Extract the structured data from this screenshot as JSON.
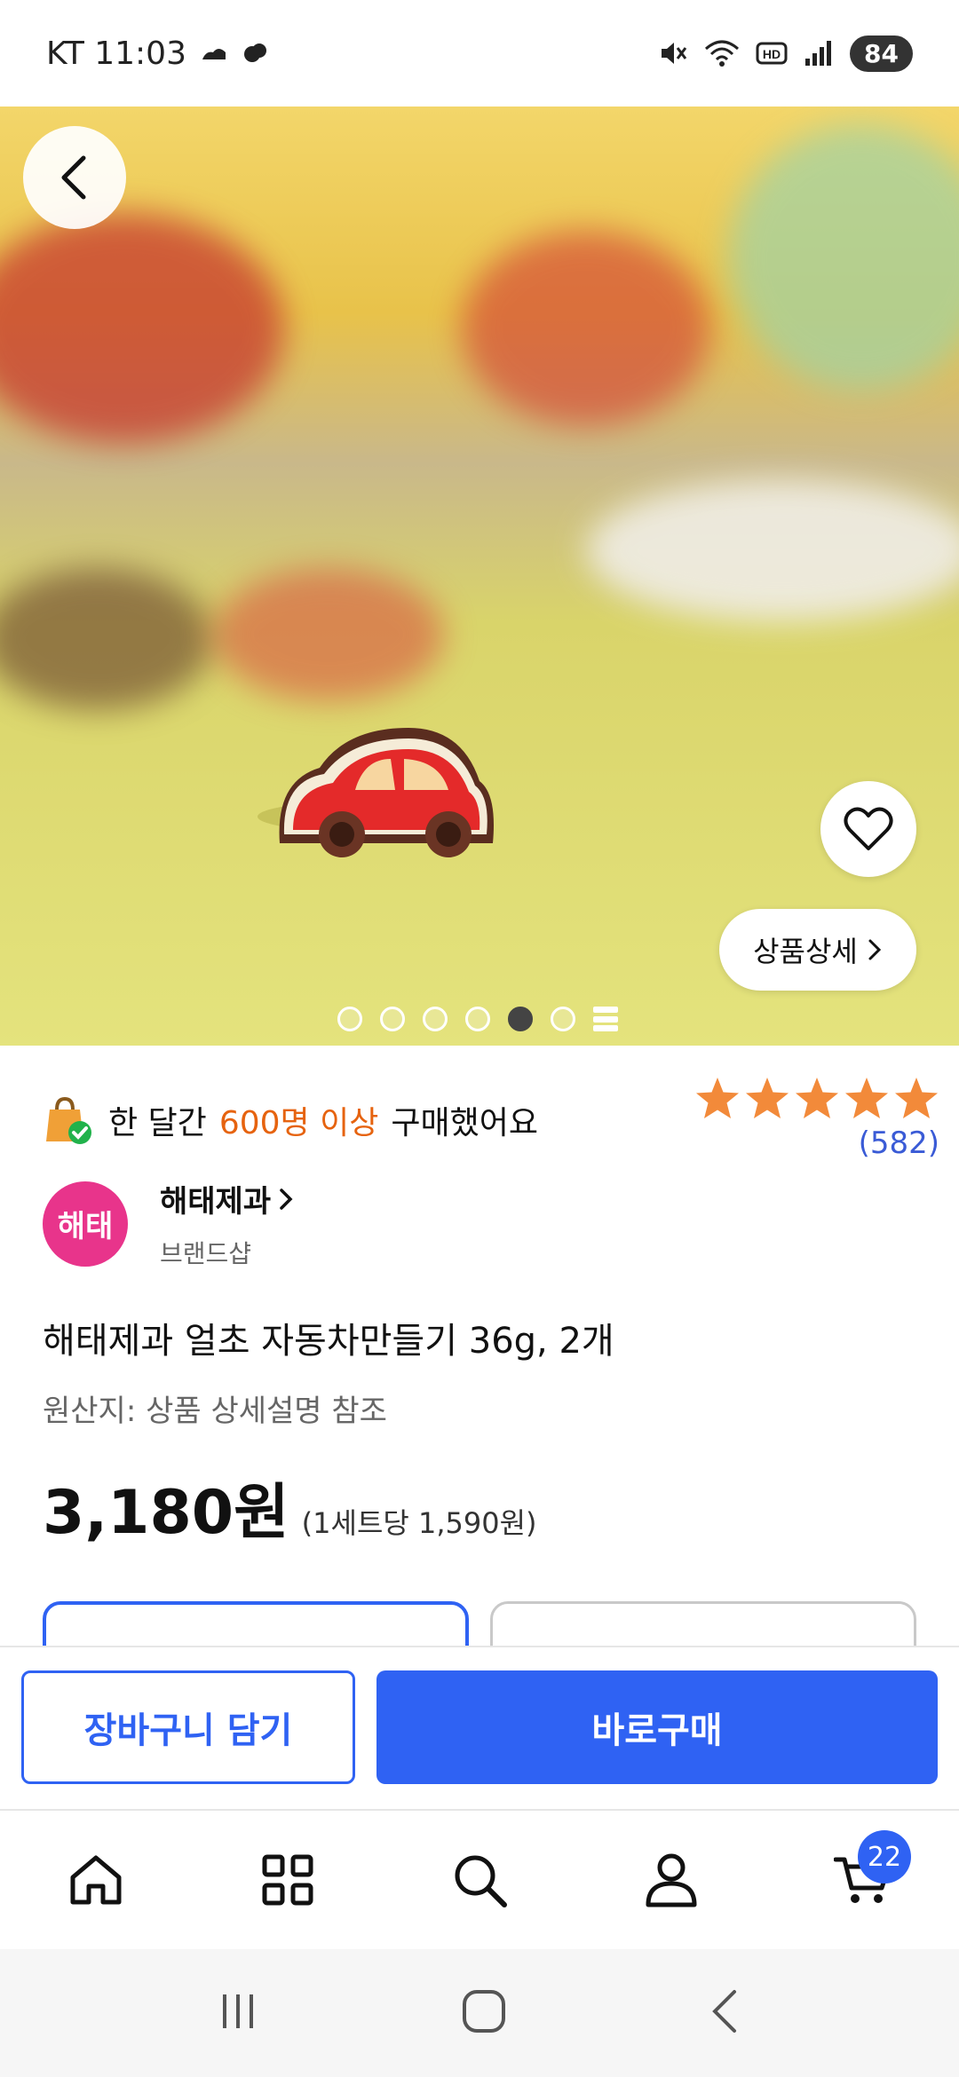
{
  "status_bar": {
    "carrier_time": "KT 11:03",
    "battery": "84"
  },
  "hero": {
    "detail_button_label": "상품상세",
    "slide_count": 6,
    "active_slide": 5
  },
  "social_proof": {
    "prefix": "한 달간",
    "highlight": "600명 이상",
    "suffix": "구매했어요"
  },
  "rating": {
    "stars": 5,
    "review_count": "(582)"
  },
  "brand": {
    "logo_text": "해태",
    "name": "해태제과",
    "subtitle": "브랜드샵"
  },
  "product": {
    "title": "해태제과 얼초 자동차만들기 36g, 2개",
    "origin": "원산지: 상품 상세설명 참조",
    "price": "3,180원",
    "unit_price": "(1세트당 1,590원)"
  },
  "actions": {
    "add_to_cart": "장바구니 담기",
    "buy_now": "바로구매"
  },
  "bottom_nav": {
    "cart_badge": "22"
  },
  "colors": {
    "primary": "#2f62f3",
    "highlight": "#e6630f",
    "star": "#f28a3a",
    "brand_logo": "#e8348b"
  }
}
